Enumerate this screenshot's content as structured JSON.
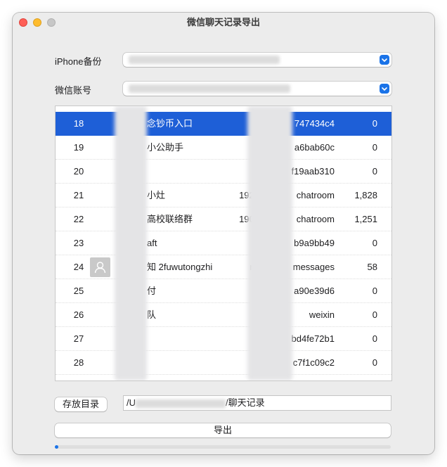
{
  "window": {
    "title": "微信聊天记录导出"
  },
  "form": {
    "backup_label": "iPhone备份",
    "backup_value": "",
    "account_label": "微信账号",
    "account_value": "",
    "chevron_icon": "chevron-up-down-icon"
  },
  "table": {
    "rows": [
      {
        "index": "18",
        "name": "念钞币入口",
        "group_id": "",
        "id": "747434c4",
        "count": "0",
        "selected": true
      },
      {
        "index": "19",
        "name": "小公助手",
        "group_id": "",
        "id": "a6bab60c",
        "count": "0"
      },
      {
        "index": "20",
        "name": "",
        "group_id": "",
        "id": "f19aab310",
        "count": "0"
      },
      {
        "index": "21",
        "name": "小灶",
        "group_id": "1926",
        "id": "chatroom",
        "count": "1,828"
      },
      {
        "index": "22",
        "name": "高校联络群",
        "group_id": "1904",
        "id": "chatroom",
        "count": "1,251"
      },
      {
        "index": "23",
        "name": "aft",
        "group_id": "",
        "id": "b9a9bb49",
        "count": "0"
      },
      {
        "index": "24",
        "name": "知 2fuwutongzhi",
        "group_id": "nc",
        "id": "messages",
        "count": "58",
        "avatar": true
      },
      {
        "index": "25",
        "name": "付",
        "group_id": "",
        "id": "a90e39d6",
        "count": "0"
      },
      {
        "index": "26",
        "name": "队",
        "group_id": "",
        "id": "weixin",
        "count": "0"
      },
      {
        "index": "27",
        "name": "",
        "group_id": "",
        "id": "bd4fe72b1",
        "count": "0"
      },
      {
        "index": "28",
        "name": "",
        "group_id": "",
        "id": "c7f1c09c2",
        "count": "0"
      }
    ]
  },
  "output": {
    "dir_button": "存放目录",
    "path_prefix": "/U",
    "path_suffix": "/聊天记录",
    "export_button": "导出",
    "progress": 0.01
  },
  "colors": {
    "selection": "#1e5fd7",
    "accent": "#1a73e8"
  }
}
